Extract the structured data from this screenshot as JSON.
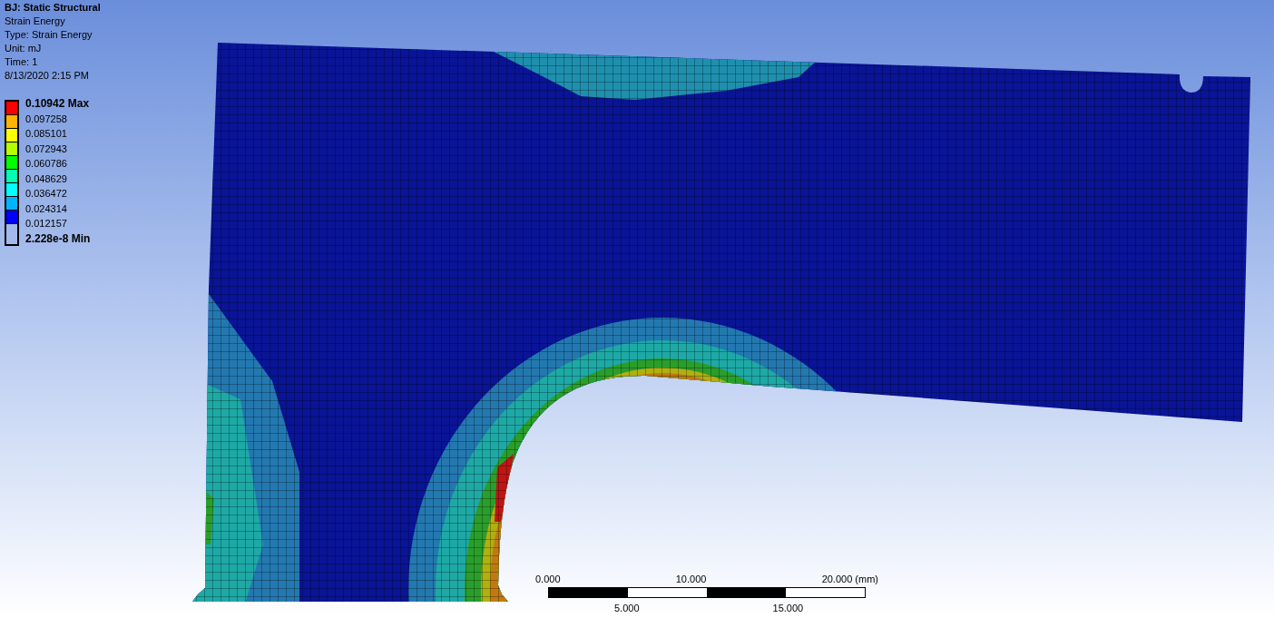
{
  "header": {
    "title": "BJ: Static Structural",
    "lines": [
      "Strain Energy",
      "Type: Strain Energy",
      "Unit: mJ",
      "Time: 1",
      "8/13/2020 2:15 PM"
    ]
  },
  "legend": {
    "labels": [
      "0.10942 Max",
      "0.097258",
      "0.085101",
      "0.072943",
      "0.060786",
      "0.048629",
      "0.036472",
      "0.024314",
      "0.012157",
      "2.228e-8 Min"
    ],
    "bands": [
      {
        "color": "#ff0000"
      },
      {
        "color": "#ffb300"
      },
      {
        "color": "#ffff00"
      },
      {
        "color": "#b3ff00"
      },
      {
        "color": "#00ff00"
      },
      {
        "color": "#00ffb3"
      },
      {
        "color": "#00ffff"
      },
      {
        "color": "#00b3ff"
      },
      {
        "color": "#0000ff"
      }
    ]
  },
  "scale_bar": {
    "top_labels": [
      "0.000",
      "10.000",
      "20.000 (mm)"
    ],
    "bottom_labels": [
      "5.000",
      "15.000"
    ]
  }
}
